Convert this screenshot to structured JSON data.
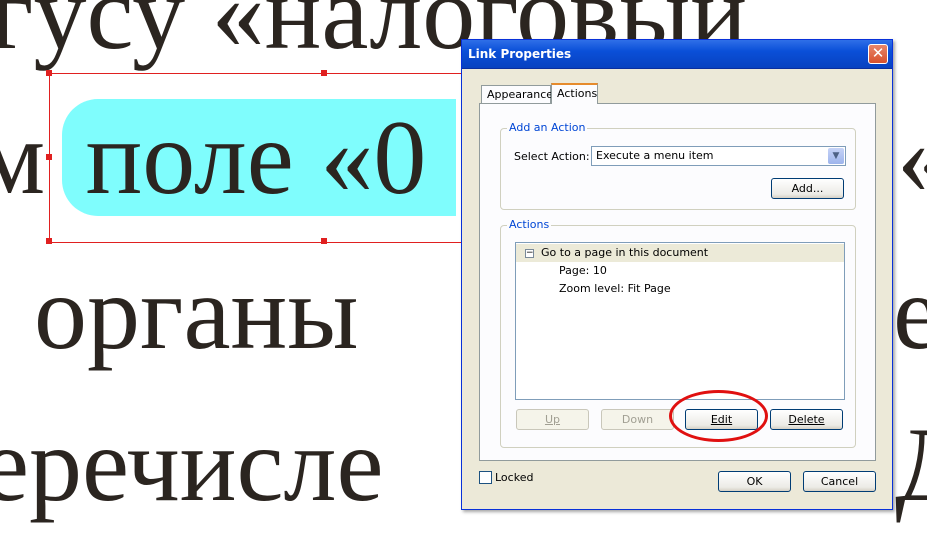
{
  "document": {
    "line1": "гусу «налоговый",
    "line2_prefix": "м ",
    "line2_highlight": "поле «0",
    "line3": "органы",
    "line4": "еречисле",
    "right_edge": [
      "",
      "«",
      "е",
      "Д"
    ]
  },
  "dialog": {
    "title": "Link Properties",
    "close_symbol": "✕",
    "tabs": [
      {
        "label": "Appearance",
        "active": false
      },
      {
        "label": "Actions",
        "active": true
      }
    ],
    "add_action": {
      "group_label": "Add an Action",
      "select_label": "Select Action:",
      "select_value": "Execute a menu item",
      "add_button": "Add..."
    },
    "actions": {
      "group_label": "Actions",
      "items": [
        {
          "label": "Go to a page in this document",
          "expanded": true
        },
        {
          "label": "Page: 10"
        },
        {
          "label": "Zoom level: Fit Page"
        }
      ],
      "buttons": {
        "up": "Up",
        "down": "Down",
        "edit": "Edit",
        "delete": "Delete"
      }
    },
    "locked_label": "Locked",
    "ok_button": "OK",
    "cancel_button": "Cancel"
  },
  "colors": {
    "accent_circle": "#e01010",
    "highlight_bg": "#7ffdfd",
    "selection_border": "#e02020",
    "titlebar_blue": "#0a4fd8"
  }
}
